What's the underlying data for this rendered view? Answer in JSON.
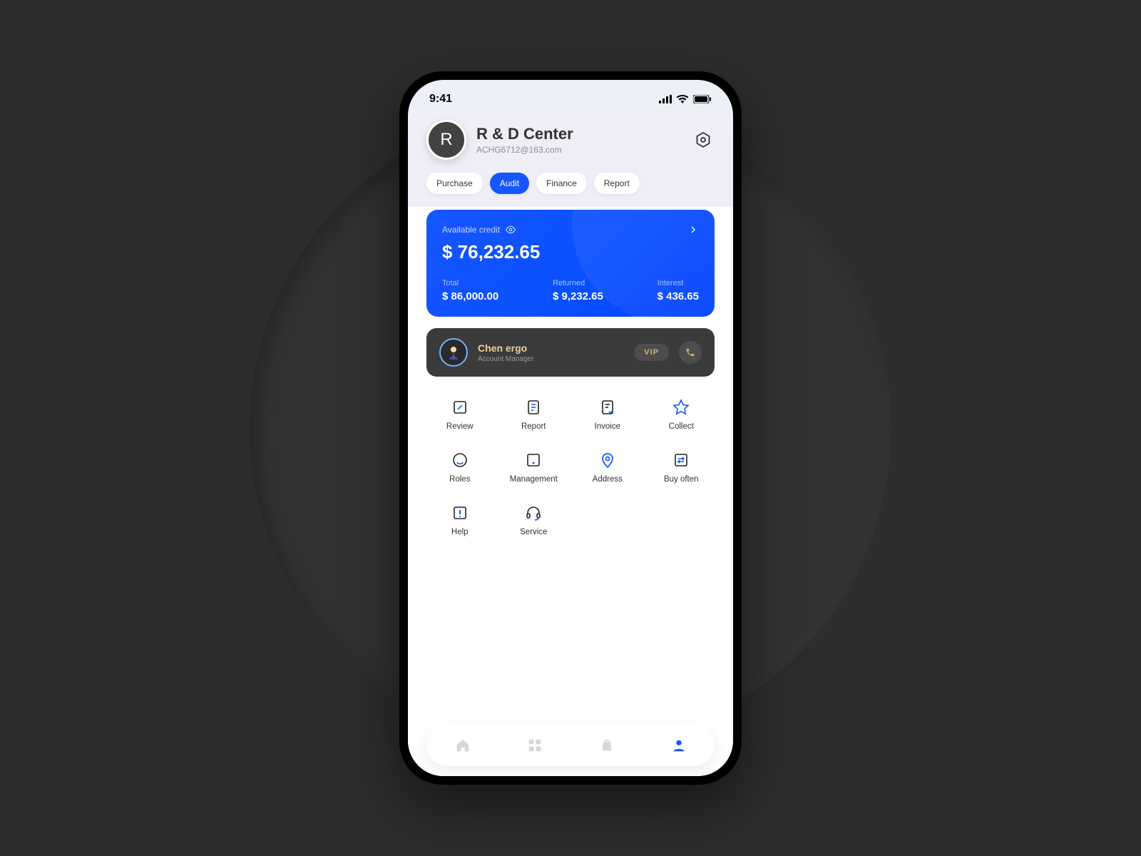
{
  "status": {
    "time": "9:41"
  },
  "header": {
    "avatar_letter": "R",
    "title": "R & D Center",
    "email": "ACHG6712@163.com"
  },
  "tabs": [
    {
      "label": "Purchase",
      "active": false
    },
    {
      "label": "Audit",
      "active": true
    },
    {
      "label": "Finance",
      "active": false
    },
    {
      "label": "Report",
      "active": false
    }
  ],
  "credit": {
    "label": "Available credit",
    "amount": "$ 76,232.65",
    "stats": [
      {
        "label": "Total",
        "value": "$ 86,000.00"
      },
      {
        "label": "Returned",
        "value": "$ 9,232.65"
      },
      {
        "label": "Interest",
        "value": "$ 436.65"
      }
    ]
  },
  "manager": {
    "name": "Chen ergo",
    "role": "Account Manager",
    "vip": "VIP"
  },
  "grid": [
    {
      "label": "Review",
      "icon": "review"
    },
    {
      "label": "Report",
      "icon": "report"
    },
    {
      "label": "Invoice",
      "icon": "invoice"
    },
    {
      "label": "Collect",
      "icon": "collect"
    },
    {
      "label": "Roles",
      "icon": "roles"
    },
    {
      "label": "Management",
      "icon": "management"
    },
    {
      "label": "Address",
      "icon": "address"
    },
    {
      "label": "Buy often",
      "icon": "buyoften"
    },
    {
      "label": "Help",
      "icon": "help"
    },
    {
      "label": "Service",
      "icon": "service"
    }
  ],
  "colors": {
    "accent": "#1556ff"
  }
}
